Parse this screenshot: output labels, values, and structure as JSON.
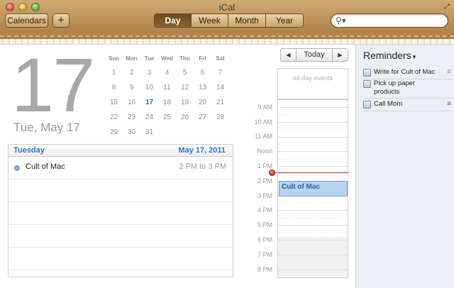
{
  "window": {
    "title": "iCal",
    "fullscreen_icon": "fullscreen-icon"
  },
  "toolbar": {
    "calendars_label": "Calendars",
    "add_label": "+",
    "views": [
      {
        "label": "Day",
        "selected": true
      },
      {
        "label": "Week",
        "selected": false
      },
      {
        "label": "Month",
        "selected": false
      },
      {
        "label": "Year",
        "selected": false
      }
    ],
    "search": {
      "placeholder": "",
      "value": "",
      "icon": "search-icon"
    }
  },
  "date_header": {
    "big_day": "17",
    "date_label": "Tue, May 17"
  },
  "mini_calendar": {
    "weekdays": [
      "Sun",
      "Mon",
      "Tue",
      "Wed",
      "Thu",
      "Fri",
      "Sat"
    ],
    "weeks": [
      [
        "1",
        "2",
        "3",
        "4",
        "5",
        "6",
        "7"
      ],
      [
        "8",
        "9",
        "10",
        "11",
        "12",
        "13",
        "14"
      ],
      [
        "15",
        "16",
        "17",
        "18",
        "19",
        "20",
        "21"
      ],
      [
        "22",
        "23",
        "24",
        "25",
        "26",
        "27",
        "28"
      ],
      [
        "29",
        "30",
        "31",
        "",
        "",
        "",
        ""
      ]
    ],
    "today": "17"
  },
  "day_panel": {
    "weekday": "Tuesday",
    "date": "May 17, 2011",
    "events": [
      {
        "title": "Cult of Mac",
        "time": "2 PM to 3 PM"
      }
    ]
  },
  "day_nav": {
    "prev": "◀",
    "today": "Today",
    "next": "▶"
  },
  "timeline": {
    "all_day_label": "all-day events",
    "hours": [
      "9 AM",
      "10 AM",
      "11 AM",
      "Noon",
      "1 PM",
      "2 PM",
      "3 PM",
      "4 PM",
      "5 PM",
      "6 PM",
      "7 PM",
      "8 PM"
    ],
    "event": {
      "title": "Cult of Mac"
    }
  },
  "reminders": {
    "title": "Reminders",
    "caret": "▾",
    "items": [
      {
        "text": "Write for Cult of Mac",
        "priority_icon": "≡"
      },
      {
        "text": "Pick up paper products",
        "priority_icon": ""
      },
      {
        "text": "Call Mom",
        "priority_icon": "≡"
      }
    ]
  },
  "colors": {
    "accent_blue": "#2f75c8",
    "leather": "#b98c51",
    "event_fill": "#b9d2ee",
    "now_line": "#d23a2e"
  }
}
